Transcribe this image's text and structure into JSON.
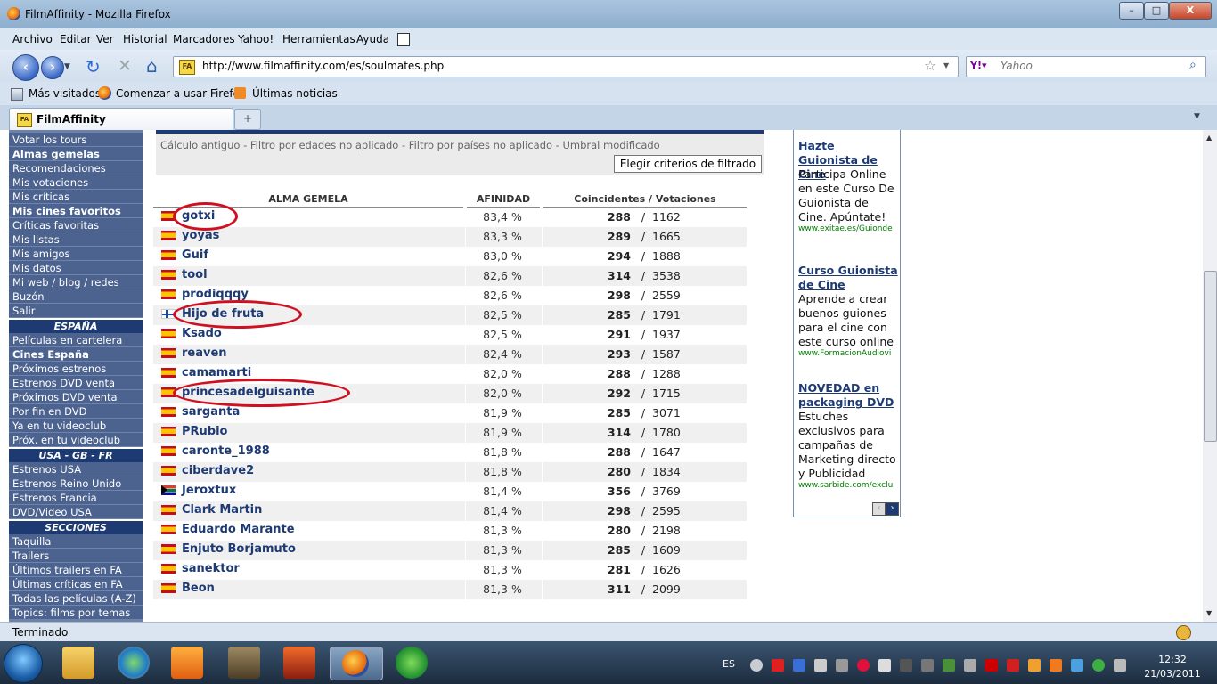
{
  "window": {
    "title": "FilmAffinity - Mozilla Firefox",
    "minimize": "–",
    "maximize": "□",
    "close": "X"
  },
  "menu": [
    "Archivo",
    "Editar",
    "Ver",
    "Historial",
    "Marcadores",
    "Yahoo!",
    "Herramientas",
    "Ayuda"
  ],
  "nav": {
    "url": "http://www.filmaffinity.com/es/soulmates.php",
    "search_placeholder": "Yahoo",
    "favicon": "FA"
  },
  "bookmarks": [
    "Más visitados",
    "Comenzar a usar Firefox",
    "Últimas noticias"
  ],
  "tab": {
    "label": "FilmAffinity",
    "new_tab": "+"
  },
  "sidebar": {
    "group1": [
      {
        "label": "Votar los tours",
        "bold": false
      },
      {
        "label": "Almas gemelas",
        "bold": true
      },
      {
        "label": "Recomendaciones",
        "bold": false
      },
      {
        "label": "Mis votaciones",
        "bold": false
      },
      {
        "label": "Mis críticas",
        "bold": false
      },
      {
        "label": "Mis cines favoritos",
        "bold": true
      },
      {
        "label": "Críticas favoritas",
        "bold": false
      },
      {
        "label": "Mis listas",
        "bold": false
      },
      {
        "label": "Mis amigos",
        "bold": false
      },
      {
        "label": "Mis datos",
        "bold": false
      },
      {
        "label": "Mi web / blog / redes",
        "bold": false
      },
      {
        "label": "Buzón",
        "bold": false
      },
      {
        "label": "Salir",
        "bold": false
      }
    ],
    "head_espana": "ESPAÑA",
    "group2": [
      {
        "label": "Películas en cartelera",
        "bold": false
      },
      {
        "label": "Cines España",
        "bold": true
      },
      {
        "label": "Próximos estrenos",
        "bold": false
      },
      {
        "label": "Estrenos DVD venta",
        "bold": false
      },
      {
        "label": "Próximos DVD venta",
        "bold": false
      },
      {
        "label": "Por fin en DVD",
        "bold": false
      },
      {
        "label": "Ya en tu videoclub",
        "bold": false
      },
      {
        "label": "Próx. en tu videoclub",
        "bold": false
      }
    ],
    "head_usa": "USA - GB - FR",
    "group3": [
      {
        "label": "Estrenos USA",
        "bold": false
      },
      {
        "label": "Estrenos Reino Unido",
        "bold": false
      },
      {
        "label": "Estrenos Francia",
        "bold": false
      },
      {
        "label": "DVD/Video USA",
        "bold": false
      }
    ],
    "head_secciones": "SECCIONES",
    "group4": [
      {
        "label": "Taquilla",
        "bold": false
      },
      {
        "label": "Trailers",
        "bold": false
      },
      {
        "label": "Últimos trailers en FA",
        "bold": false
      },
      {
        "label": "Últimas críticas en FA",
        "bold": false
      },
      {
        "label": "Todas las películas (A-Z)",
        "bold": false
      },
      {
        "label": "Topics: films por temas",
        "bold": false
      }
    ]
  },
  "filter": {
    "text": "Cálculo antiguo - Filtro por edades no aplicado - Filtro por países no aplicado - Umbral modificado",
    "button": "Elegir criterios de filtrado"
  },
  "table": {
    "headers": [
      "ALMA GEMELA",
      "AFINIDAD",
      "Coincidentes / Votaciones"
    ],
    "rows": [
      {
        "name": "gotxi",
        "flag": "es",
        "affinity": "83,4 %",
        "coincidentes": "288",
        "votaciones": "1162",
        "circled": true
      },
      {
        "name": "yoyas",
        "flag": "es",
        "affinity": "83,3 %",
        "coincidentes": "289",
        "votaciones": "1665",
        "circled": false
      },
      {
        "name": "Guif",
        "flag": "es",
        "affinity": "83,0 %",
        "coincidentes": "294",
        "votaciones": "1888",
        "circled": false
      },
      {
        "name": "tool",
        "flag": "es",
        "affinity": "82,6 %",
        "coincidentes": "314",
        "votaciones": "3538",
        "circled": false
      },
      {
        "name": "prodiqqqy",
        "flag": "es",
        "affinity": "82,6 %",
        "coincidentes": "298",
        "votaciones": "2559",
        "circled": false
      },
      {
        "name": "Hijo de fruta",
        "flag": "fi",
        "affinity": "82,5 %",
        "coincidentes": "285",
        "votaciones": "1791",
        "circled": true
      },
      {
        "name": "Ksado",
        "flag": "es",
        "affinity": "82,5 %",
        "coincidentes": "291",
        "votaciones": "1937",
        "circled": false
      },
      {
        "name": "reaven",
        "flag": "es",
        "affinity": "82,4 %",
        "coincidentes": "293",
        "votaciones": "1587",
        "circled": false
      },
      {
        "name": "camamarti",
        "flag": "es",
        "affinity": "82,0 %",
        "coincidentes": "288",
        "votaciones": "1288",
        "circled": false
      },
      {
        "name": "princesadelguisante",
        "flag": "es",
        "affinity": "82,0 %",
        "coincidentes": "292",
        "votaciones": "1715",
        "circled": true
      },
      {
        "name": "sarganta",
        "flag": "es",
        "affinity": "81,9 %",
        "coincidentes": "285",
        "votaciones": "3071",
        "circled": false
      },
      {
        "name": "PRubio",
        "flag": "es",
        "affinity": "81,9 %",
        "coincidentes": "314",
        "votaciones": "1780",
        "circled": false
      },
      {
        "name": "caronte_1988",
        "flag": "es",
        "affinity": "81,8 %",
        "coincidentes": "288",
        "votaciones": "1647",
        "circled": false
      },
      {
        "name": "ciberdave2",
        "flag": "es",
        "affinity": "81,8 %",
        "coincidentes": "280",
        "votaciones": "1834",
        "circled": false
      },
      {
        "name": "Jeroxtux",
        "flag": "za",
        "affinity": "81,4 %",
        "coincidentes": "356",
        "votaciones": "3769",
        "circled": false
      },
      {
        "name": "Clark Martin",
        "flag": "es",
        "affinity": "81,4 %",
        "coincidentes": "298",
        "votaciones": "2595",
        "circled": false
      },
      {
        "name": "Eduardo Marante",
        "flag": "es",
        "affinity": "81,3 %",
        "coincidentes": "280",
        "votaciones": "2198",
        "circled": false
      },
      {
        "name": "Enjuto Borjamuto",
        "flag": "es",
        "affinity": "81,3 %",
        "coincidentes": "285",
        "votaciones": "1609",
        "circled": false
      },
      {
        "name": "sanektor",
        "flag": "es",
        "affinity": "81,3 %",
        "coincidentes": "281",
        "votaciones": "1626",
        "circled": false
      },
      {
        "name": "Beon",
        "flag": "es",
        "affinity": "81,3 %",
        "coincidentes": "311",
        "votaciones": "2099",
        "circled": false
      }
    ]
  },
  "ads": [
    {
      "title": "Hazte Guionista de Cine",
      "body": "Participa Online en este Curso De Guionista de Cine. Apúntate!",
      "url": "www.exitae.es/Guionde"
    },
    {
      "title": "Curso Guionista de Cine",
      "body": "Aprende a crear buenos guiones para el cine con este curso online",
      "url": "www.FormacionAudiovi"
    },
    {
      "title": "NOVEDAD en packaging DVD",
      "body": "Estuches exclusivos para campañas de Marketing directo y Publicidad",
      "url": "www.sarbide.com/exclu"
    }
  ],
  "status": "Terminado",
  "taskbar": {
    "lang": "ES",
    "time": "12:32",
    "date": "21/03/2011"
  },
  "colors": {
    "accent": "#1e3a73",
    "sidebar_item": "#4c6390",
    "circle": "#d01020"
  }
}
